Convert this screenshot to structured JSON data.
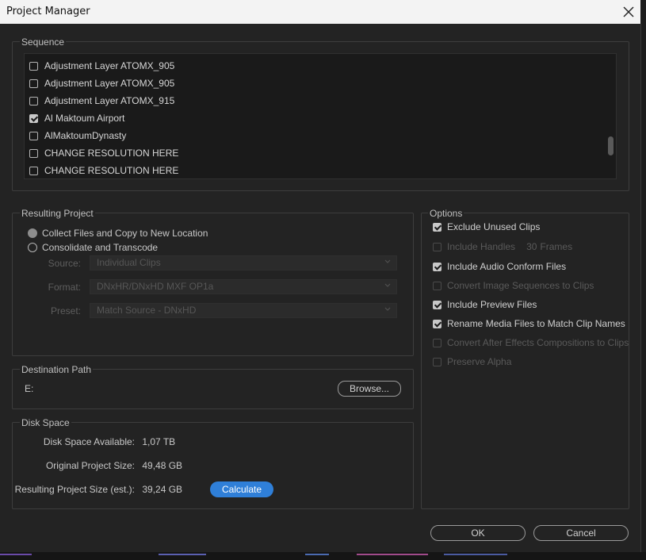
{
  "window": {
    "title": "Project Manager"
  },
  "sequence": {
    "label": "Sequence",
    "items": [
      {
        "label": "Adjustment Layer ATOMX_905",
        "checked": false
      },
      {
        "label": "Adjustment Layer ATOMX_905",
        "checked": false
      },
      {
        "label": "Adjustment Layer ATOMX_915",
        "checked": false
      },
      {
        "label": "Al Maktoum Airport",
        "checked": true
      },
      {
        "label": "AlMaktoumDynasty",
        "checked": false
      },
      {
        "label": "CHANGE RESOLUTION HERE",
        "checked": false
      },
      {
        "label": "CHANGE RESOLUTION HERE",
        "checked": false
      }
    ]
  },
  "resulting_project": {
    "label": "Resulting Project",
    "collect_label": "Collect Files and Copy to New Location",
    "consolidate_label": "Consolidate and Transcode",
    "selected": "collect",
    "source": {
      "label": "Source:",
      "value": "Individual Clips"
    },
    "format": {
      "label": "Format:",
      "value": "DNxHR/DNxHD MXF OP1a"
    },
    "preset": {
      "label": "Preset:",
      "value": "Match Source - DNxHD"
    }
  },
  "options": {
    "label": "Options",
    "exclude_unused": {
      "label": "Exclude Unused Clips",
      "checked": true,
      "enabled": true
    },
    "include_handles": {
      "label": "Include Handles",
      "value": "30",
      "unit": "Frames",
      "checked": false,
      "enabled": false
    },
    "include_audio_conform": {
      "label": "Include Audio Conform Files",
      "checked": true,
      "enabled": true
    },
    "convert_image_sequences": {
      "label": "Convert Image Sequences to Clips",
      "checked": false,
      "enabled": false
    },
    "include_preview": {
      "label": "Include Preview Files",
      "checked": true,
      "enabled": true
    },
    "rename_media": {
      "label": "Rename Media Files to Match Clip Names",
      "checked": true,
      "enabled": true
    },
    "convert_ae": {
      "label": "Convert After Effects Compositions to Clips",
      "checked": false,
      "enabled": false
    },
    "preserve_alpha": {
      "label": "Preserve Alpha",
      "checked": false,
      "enabled": false
    }
  },
  "destination": {
    "label": "Destination Path",
    "path": "E:",
    "browse_label": "Browse..."
  },
  "disk_space": {
    "label": "Disk Space",
    "available_label": "Disk Space Available:",
    "available_value": "1,07 TB",
    "original_label": "Original Project Size:",
    "original_value": "49,48 GB",
    "resulting_label": "Resulting Project Size (est.):",
    "resulting_value": "39,24 GB",
    "calculate_label": "Calculate"
  },
  "footer": {
    "ok_label": "OK",
    "cancel_label": "Cancel"
  },
  "colors": {
    "accent": "#2f7fd8",
    "background": "#232323",
    "titlebar": "#f3f3f3"
  }
}
